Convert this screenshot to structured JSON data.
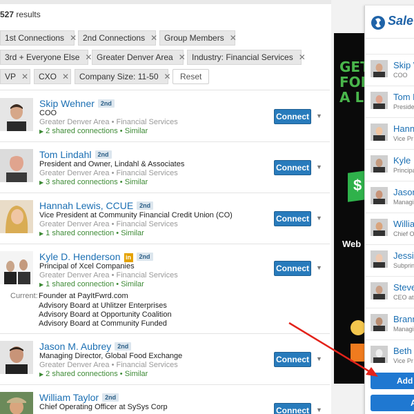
{
  "results": {
    "count": "527",
    "suffix": "results"
  },
  "filters": [
    {
      "label": "1st Connections"
    },
    {
      "label": "2nd Connections"
    },
    {
      "label": "Group Members"
    },
    {
      "label": "3rd + Everyone Else"
    },
    {
      "label": "Greater Denver Area"
    },
    {
      "label": "Industry: Financial Services"
    },
    {
      "label": "VP"
    },
    {
      "label": "CXO"
    },
    {
      "label": "Company Size: 11-50"
    }
  ],
  "reset_label": "Reset",
  "connect_label": "Connect",
  "people": [
    {
      "name": "Skip Wehner",
      "degree": "2nd",
      "title": "COO",
      "location": "Greater Denver Area",
      "industry": "Financial Services",
      "shared": "2 shared connections",
      "similar": "Similar"
    },
    {
      "name": "Tom Lindahl",
      "degree": "2nd",
      "title": "President and Owner, Lindahl & Associates",
      "location": "Greater Denver Area",
      "industry": "Financial Services",
      "shared": "3 shared connections",
      "similar": "Similar"
    },
    {
      "name": "Hannah Lewis, CCUE",
      "degree": "2nd",
      "title": "Vice President at Community Financial Credit Union (CO)",
      "location": "Greater Denver Area",
      "industry": "Financial Services",
      "shared": "1 shared connection",
      "similar": "Similar"
    },
    {
      "name": "Kyle D. Henderson",
      "degree": "2nd",
      "inbadge": "in",
      "title": "Principal of Xcel Companies",
      "location": "Greater Denver Area",
      "industry": "Financial Services",
      "shared": "1 shared connection",
      "similar": "Similar",
      "current_label": "Current:",
      "current": [
        "Founder at PayItFwrd.com",
        "Advisory Board at Uhlitzer Enterprises",
        "Advisory Board at Opportunity Coalition",
        "Advisory Board at Community Funded"
      ]
    },
    {
      "name": "Jason M. Aubrey",
      "degree": "2nd",
      "title": "Managing Director, Global Food Exchange",
      "location": "Greater Denver Area",
      "industry": "Financial Services",
      "shared": "2 shared connections",
      "similar": "Similar"
    },
    {
      "name": "William Taylor",
      "degree": "2nd",
      "title": "Chief Operating Officer at SySys Corp",
      "location": "",
      "industry": "",
      "shared": "",
      "similar": ""
    }
  ],
  "separator": "•",
  "ad": {
    "lines": [
      "GET",
      "FOR",
      "A L"
    ],
    "dollar": "$",
    "web": "Web"
  },
  "salesforce": {
    "logo": "Sale",
    "items": [
      {
        "name": "Skip W",
        "sub": "COO"
      },
      {
        "name": "Tom L",
        "sub": "Preside"
      },
      {
        "name": "Hann",
        "sub": "Vice Pr"
      },
      {
        "name": "Kyle I",
        "sub": "Principa"
      },
      {
        "name": "Jason",
        "sub": "Managi"
      },
      {
        "name": "Willia",
        "sub": "Chief O"
      },
      {
        "name": "Jessic",
        "sub": "Subprin"
      },
      {
        "name": "Steve",
        "sub": "CEO at"
      },
      {
        "name": "Brann",
        "sub": "Managi"
      },
      {
        "name": "Beth",
        "sub": "Vice Pr"
      }
    ],
    "add_label": "Add A",
    "add2_label": "A"
  },
  "colors": {
    "link": "#1b6fb3",
    "connect": "#287bbc",
    "shared": "#3d8a35",
    "arrow": "#e3231b",
    "sf_button": "#1f78d1"
  }
}
